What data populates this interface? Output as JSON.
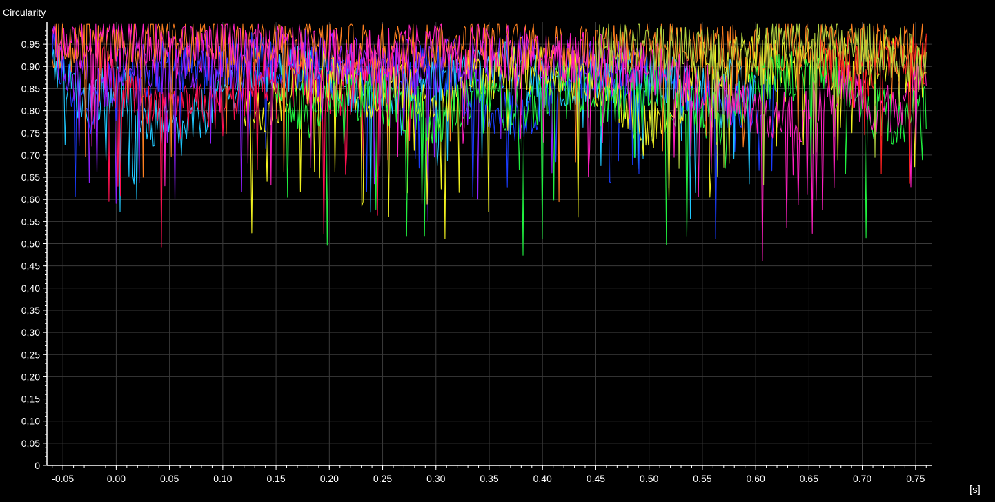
{
  "chart_data": {
    "type": "line",
    "title": "",
    "ylabel": "Circularity",
    "xlabel": "[s]",
    "xlim": [
      -0.065,
      0.765
    ],
    "ylim": [
      0,
      1.0
    ],
    "grid": true,
    "legend": "none",
    "background": "#000000",
    "grid_color": "#3a3a3a",
    "x_ticks": [
      -0.05,
      0.0,
      0.05,
      0.1,
      0.15,
      0.2,
      0.25,
      0.3,
      0.35,
      0.4,
      0.45,
      0.5,
      0.55,
      0.6,
      0.65,
      0.7,
      0.75
    ],
    "x_tick_labels": [
      "-0.05",
      "0.00",
      "0.05",
      "0.10",
      "0.15",
      "0.20",
      "0.25",
      "0.30",
      "0.35",
      "0.40",
      "0.45",
      "0.50",
      "0.55",
      "0.60",
      "0.65",
      "0.70",
      "0.75"
    ],
    "y_ticks": [
      0,
      0.05,
      0.1,
      0.15,
      0.2,
      0.25,
      0.3,
      0.35,
      0.4,
      0.45,
      0.5,
      0.55,
      0.6,
      0.65,
      0.7,
      0.75,
      0.8,
      0.85,
      0.9,
      0.95
    ],
    "y_tick_labels": [
      "0",
      "0,05",
      "0,10",
      "0,15",
      "0,20",
      "0,25",
      "0,30",
      "0,35",
      "0,40",
      "0,45",
      "0,50",
      "0,55",
      "0,60",
      "0,65",
      "0,70",
      "0,75",
      "0,80",
      "0,85",
      "0,90",
      "0,95"
    ],
    "series": [
      {
        "color": "#1a3cff",
        "x": [
          -0.06,
          -0.04,
          -0.02,
          0.0,
          0.02,
          0.05,
          0.08,
          0.12,
          0.18,
          0.24,
          0.3,
          0.34,
          0.38,
          0.42,
          0.47,
          0.52,
          0.56,
          0.59,
          0.62
        ],
        "y": [
          0.93,
          0.84,
          0.8,
          0.9,
          0.86,
          0.91,
          0.88,
          0.92,
          0.9,
          0.87,
          0.9,
          0.82,
          0.78,
          0.88,
          0.9,
          0.86,
          0.83,
          0.8,
          0.88
        ]
      },
      {
        "color": "#20c8ff",
        "x": [
          -0.06,
          -0.03,
          0.0,
          0.03,
          0.06,
          0.09,
          0.12,
          0.16,
          0.2,
          0.25,
          0.3,
          0.36,
          0.42,
          0.48,
          0.55,
          0.6
        ],
        "y": [
          0.92,
          0.82,
          0.86,
          0.78,
          0.74,
          0.82,
          0.88,
          0.9,
          0.87,
          0.84,
          0.88,
          0.9,
          0.86,
          0.88,
          0.85,
          0.87
        ]
      },
      {
        "color": "#ff1050",
        "x": [
          -0.02,
          0.0,
          0.03,
          0.05,
          0.08,
          0.1,
          0.12,
          0.15,
          0.2,
          0.24,
          0.28
        ],
        "y": [
          0.92,
          0.85,
          0.8,
          0.78,
          0.82,
          0.8,
          0.86,
          0.88,
          0.84,
          0.86,
          0.9
        ]
      },
      {
        "color": "#9020ff",
        "x": [
          -0.06,
          -0.04,
          -0.01,
          0.02,
          0.05,
          0.08,
          0.12,
          0.16,
          0.22,
          0.3,
          0.38,
          0.44,
          0.5
        ],
        "y": [
          0.94,
          0.88,
          0.86,
          0.9,
          0.88,
          0.92,
          0.9,
          0.93,
          0.91,
          0.9,
          0.92,
          0.9,
          0.91
        ]
      },
      {
        "color": "#f0f020",
        "x": [
          0.12,
          0.14,
          0.17,
          0.2,
          0.24,
          0.28,
          0.3,
          0.34,
          0.4,
          0.46,
          0.49,
          0.51,
          0.55,
          0.6,
          0.66,
          0.72,
          0.76
        ],
        "y": [
          0.82,
          0.8,
          0.86,
          0.88,
          0.84,
          0.86,
          0.8,
          0.88,
          0.9,
          0.86,
          0.78,
          0.76,
          0.9,
          0.92,
          0.9,
          0.92,
          0.88
        ]
      },
      {
        "color": "#20f040",
        "x": [
          0.15,
          0.18,
          0.22,
          0.26,
          0.3,
          0.34,
          0.38,
          0.42,
          0.46,
          0.5,
          0.54,
          0.57,
          0.6,
          0.66,
          0.7,
          0.73,
          0.76
        ],
        "y": [
          0.86,
          0.8,
          0.84,
          0.82,
          0.78,
          0.84,
          0.8,
          0.86,
          0.82,
          0.86,
          0.8,
          0.78,
          0.86,
          0.9,
          0.82,
          0.78,
          0.8
        ]
      },
      {
        "color": "#ff8020",
        "x": [
          -0.06,
          -0.03,
          0.0,
          0.04,
          0.08,
          0.12,
          0.16,
          0.2,
          0.26,
          0.32,
          0.4,
          0.48,
          0.56,
          0.64,
          0.7,
          0.76
        ],
        "y": [
          0.95,
          0.94,
          0.96,
          0.95,
          0.94,
          0.95,
          0.94,
          0.95,
          0.94,
          0.95,
          0.94,
          0.95,
          0.94,
          0.95,
          0.94,
          0.95
        ]
      },
      {
        "color": "#ff20c0",
        "x": [
          -0.06,
          -0.02,
          0.02,
          0.06,
          0.1,
          0.16,
          0.22,
          0.3,
          0.4,
          0.5,
          0.58,
          0.64,
          0.68,
          0.72,
          0.76
        ],
        "y": [
          0.96,
          0.94,
          0.95,
          0.93,
          0.95,
          0.94,
          0.92,
          0.94,
          0.93,
          0.9,
          0.82,
          0.78,
          0.86,
          0.8,
          0.86
        ]
      },
      {
        "color": "#ff2020",
        "x": [
          0.66,
          0.68,
          0.7,
          0.72,
          0.74,
          0.76
        ],
        "y": [
          0.9,
          0.92,
          0.88,
          0.91,
          0.9,
          0.92
        ]
      },
      {
        "color": "#b0d040",
        "x": [
          0.45,
          0.5,
          0.55,
          0.6,
          0.65,
          0.7,
          0.74,
          0.76
        ],
        "y": [
          0.94,
          0.95,
          0.94,
          0.95,
          0.96,
          0.94,
          0.93,
          0.88
        ]
      }
    ]
  }
}
